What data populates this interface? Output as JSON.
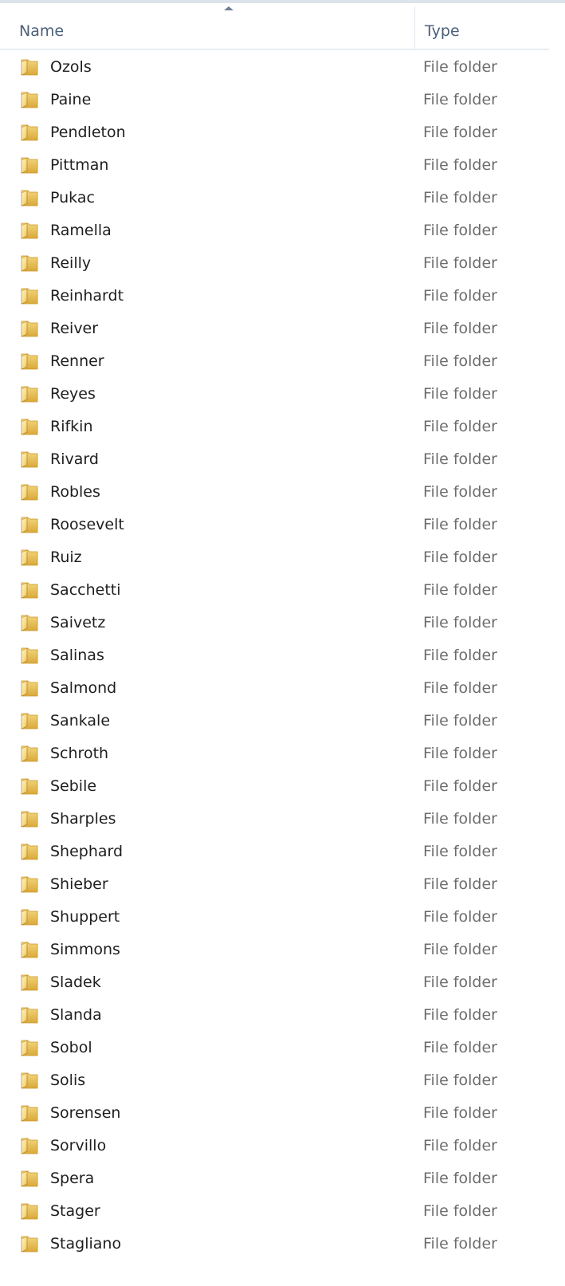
{
  "columns": {
    "name": "Name",
    "type": "Type"
  },
  "icons": {
    "folder": "folder-icon",
    "sort": "sort-ascending-icon"
  },
  "colors": {
    "header_text": "#4c607a",
    "name_text": "#1e1e1e",
    "type_text": "#6d6d6d"
  },
  "items": [
    {
      "name": "Ozols",
      "type": "File folder"
    },
    {
      "name": "Paine",
      "type": "File folder"
    },
    {
      "name": "Pendleton",
      "type": "File folder"
    },
    {
      "name": "Pittman",
      "type": "File folder"
    },
    {
      "name": "Pukac",
      "type": "File folder"
    },
    {
      "name": "Ramella",
      "type": "File folder"
    },
    {
      "name": "Reilly",
      "type": "File folder"
    },
    {
      "name": "Reinhardt",
      "type": "File folder"
    },
    {
      "name": "Reiver",
      "type": "File folder"
    },
    {
      "name": "Renner",
      "type": "File folder"
    },
    {
      "name": "Reyes",
      "type": "File folder"
    },
    {
      "name": "Rifkin",
      "type": "File folder"
    },
    {
      "name": "Rivard",
      "type": "File folder"
    },
    {
      "name": "Robles",
      "type": "File folder"
    },
    {
      "name": "Roosevelt",
      "type": "File folder"
    },
    {
      "name": "Ruiz",
      "type": "File folder"
    },
    {
      "name": "Sacchetti",
      "type": "File folder"
    },
    {
      "name": "Saivetz",
      "type": "File folder"
    },
    {
      "name": "Salinas",
      "type": "File folder"
    },
    {
      "name": "Salmond",
      "type": "File folder"
    },
    {
      "name": "Sankale",
      "type": "File folder"
    },
    {
      "name": "Schroth",
      "type": "File folder"
    },
    {
      "name": "Sebile",
      "type": "File folder"
    },
    {
      "name": "Sharples",
      "type": "File folder"
    },
    {
      "name": "Shephard",
      "type": "File folder"
    },
    {
      "name": "Shieber",
      "type": "File folder"
    },
    {
      "name": "Shuppert",
      "type": "File folder"
    },
    {
      "name": "Simmons",
      "type": "File folder"
    },
    {
      "name": "Sladek",
      "type": "File folder"
    },
    {
      "name": "Slanda",
      "type": "File folder"
    },
    {
      "name": "Sobol",
      "type": "File folder"
    },
    {
      "name": "Solis",
      "type": "File folder"
    },
    {
      "name": "Sorensen",
      "type": "File folder"
    },
    {
      "name": "Sorvillo",
      "type": "File folder"
    },
    {
      "name": "Spera",
      "type": "File folder"
    },
    {
      "name": "Stager",
      "type": "File folder"
    },
    {
      "name": "Stagliano",
      "type": "File folder"
    }
  ]
}
